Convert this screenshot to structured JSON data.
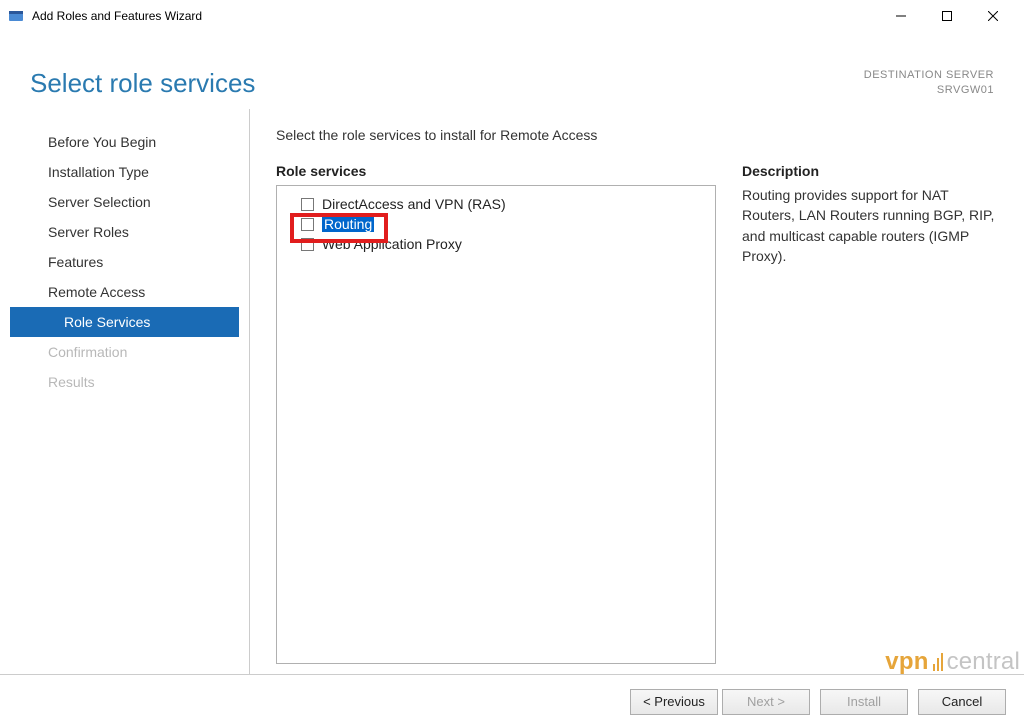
{
  "window": {
    "title": "Add Roles and Features Wizard"
  },
  "header": {
    "page_title": "Select role services",
    "dest_label": "DESTINATION SERVER",
    "dest_server": "SRVGW01"
  },
  "steps": [
    {
      "label": "Before You Begin",
      "state": "normal"
    },
    {
      "label": "Installation Type",
      "state": "normal"
    },
    {
      "label": "Server Selection",
      "state": "normal"
    },
    {
      "label": "Server Roles",
      "state": "normal"
    },
    {
      "label": "Features",
      "state": "normal"
    },
    {
      "label": "Remote Access",
      "state": "normal"
    },
    {
      "label": "Role Services",
      "state": "selected"
    },
    {
      "label": "Confirmation",
      "state": "disabled"
    },
    {
      "label": "Results",
      "state": "disabled"
    }
  ],
  "main": {
    "intro": "Select the role services to install for Remote Access",
    "list_label": "Role services",
    "items": [
      {
        "label": "DirectAccess and VPN (RAS)",
        "checked": false,
        "selected": false
      },
      {
        "label": "Routing",
        "checked": false,
        "selected": true
      },
      {
        "label": "Web Application Proxy",
        "checked": false,
        "selected": false
      }
    ],
    "desc_label": "Description",
    "desc_text": "Routing provides support for NAT Routers, LAN Routers running BGP, RIP, and multicast capable routers (IGMP Proxy)."
  },
  "footer": {
    "previous": "< Previous",
    "next": "Next >",
    "install": "Install",
    "cancel": "Cancel"
  },
  "watermark": {
    "left": "vpn",
    "right": "central"
  }
}
